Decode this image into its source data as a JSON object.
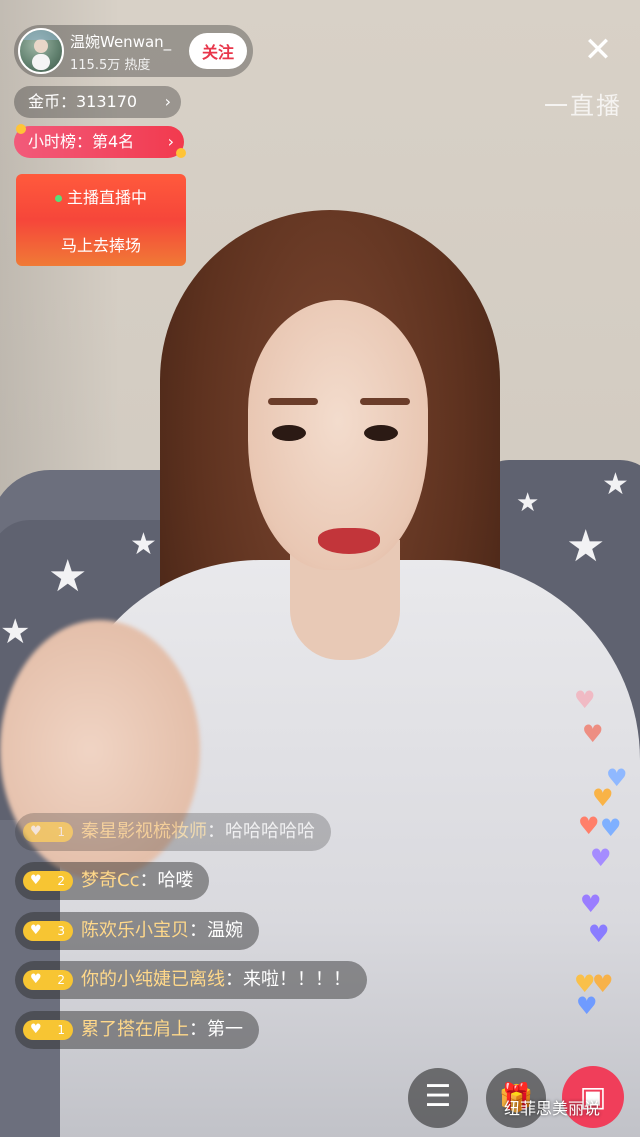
{
  "anchor": {
    "name": "温婉Wenwan_",
    "heat": "115.5万 热度",
    "follow_label": "关注",
    "avatar_icon": "user-avatar"
  },
  "header": {
    "close_glyph": "✕",
    "watermark": "一直播"
  },
  "coins": {
    "text": "金币：313170",
    "chevron": "›"
  },
  "rank": {
    "text": "小时榜：第4名",
    "chevron": "›"
  },
  "live_card": {
    "line1": "主播直播中",
    "line2": "马上去捧场"
  },
  "chat": [
    {
      "level": "1",
      "user": "秦星影视梳妆师",
      "text": "哈哈哈哈哈"
    },
    {
      "level": "2",
      "user": "梦奇Cc",
      "text": "哈喽"
    },
    {
      "level": "3",
      "user": "陈欢乐小宝贝",
      "text": "温婉"
    },
    {
      "level": "2",
      "user": "你的小纯婕已离线",
      "text": "来啦！！！！"
    },
    {
      "level": "1",
      "user": "累了搭在肩上",
      "text": "第一"
    }
  ],
  "chat_separator": "：",
  "badge_icon": "♥",
  "bottom": {
    "menu_glyph": "☰",
    "gift_glyph": "🎁",
    "share_glyph": "▣",
    "brand_watermark": "纽菲思美丽说"
  },
  "colors": {
    "follow_text": "#e8364b",
    "rank_bg": "#f23a4e",
    "live_card_bg": "#f6463a",
    "badge": "#f7c533",
    "red_button": "#f03e5a"
  }
}
